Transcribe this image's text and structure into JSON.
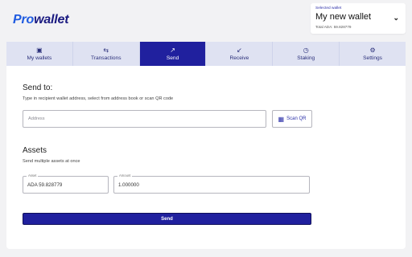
{
  "app": {
    "logo_pro": "Pro",
    "logo_wallet": "wallet"
  },
  "wallet_selector": {
    "label": "Selected wallet",
    "name": "My new wallet",
    "total": "Total ADA: 59.828779"
  },
  "tabs": [
    {
      "label": "My wallets",
      "icon": "wallet-icon",
      "glyph": "▣"
    },
    {
      "label": "Transactions",
      "icon": "transactions-icon",
      "glyph": "⇆"
    },
    {
      "label": "Send",
      "icon": "send-arrow-icon",
      "glyph": "↗"
    },
    {
      "label": "Receive",
      "icon": "receive-arrow-icon",
      "glyph": "↙"
    },
    {
      "label": "Staking",
      "icon": "staking-icon",
      "glyph": "◷"
    },
    {
      "label": "Settings",
      "icon": "gear-icon",
      "glyph": "⚙"
    }
  ],
  "active_tab": "Send",
  "send_to": {
    "heading": "Send to:",
    "subtitle": "Type in recipient wallet address, select from address book or scan QR code",
    "address_placeholder": "Address",
    "scan_label": "Scan QR"
  },
  "assets": {
    "heading": "Assets",
    "subtitle": "Send multiple assets at once",
    "asset_label": "Asset",
    "asset_value": "ADA 59.828779",
    "amount_label": "Amount",
    "amount_value": "1.000000"
  },
  "send_button": "Send",
  "colors": {
    "accent": "#20209e",
    "tab_bg": "#dfe2f2",
    "logo_blue": "#1f5be0"
  }
}
